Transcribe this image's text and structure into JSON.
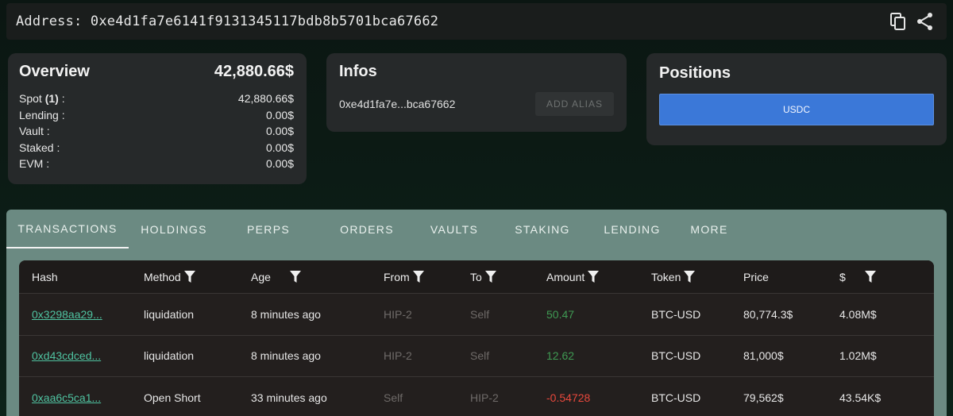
{
  "address_bar": {
    "label": "Address:",
    "address": "0xe4d1fa7e6141f9131345117bdb8b5701bca67662",
    "icons": [
      "copy-icon",
      "share-icon"
    ]
  },
  "overview": {
    "title": "Overview",
    "total": "42,880.66$",
    "rows": [
      {
        "label_prefix": "Spot ",
        "label_bold": "(1)",
        "label_suffix": " :",
        "value": "42,880.66$"
      },
      {
        "label_prefix": "Lending :",
        "label_bold": "",
        "label_suffix": "",
        "value": "0.00$"
      },
      {
        "label_prefix": "Vault :",
        "label_bold": "",
        "label_suffix": "",
        "value": "0.00$"
      },
      {
        "label_prefix": "Staked :",
        "label_bold": "",
        "label_suffix": "",
        "value": "0.00$"
      },
      {
        "label_prefix": "EVM :",
        "label_bold": "",
        "label_suffix": "",
        "value": "0.00$"
      }
    ]
  },
  "infos": {
    "title": "Infos",
    "short_address": "0xe4d1fa7e...bca67662",
    "alias_button": "ADD ALIAS"
  },
  "positions": {
    "title": "Positions",
    "token_button": "USDC"
  },
  "tabs": [
    {
      "label": "TRANSACTIONS",
      "active": true
    },
    {
      "label": "HOLDINGS",
      "active": false
    },
    {
      "label": "PERPS",
      "active": false
    },
    {
      "label": "ORDERS",
      "active": false
    },
    {
      "label": "VAULTS",
      "active": false
    },
    {
      "label": "STAKING",
      "active": false
    },
    {
      "label": "LENDING",
      "active": false
    },
    {
      "label": "MORE",
      "active": false
    }
  ],
  "table": {
    "columns": [
      {
        "label": "Hash",
        "filter": false
      },
      {
        "label": "Method",
        "filter": true
      },
      {
        "label": "Age",
        "filter": true
      },
      {
        "label": "From",
        "filter": true
      },
      {
        "label": "To",
        "filter": true
      },
      {
        "label": "Amount",
        "filter": true
      },
      {
        "label": "Token",
        "filter": true
      },
      {
        "label": "Price",
        "filter": false
      },
      {
        "label": "$",
        "filter": true
      }
    ],
    "rows": [
      {
        "hash": "0x3298aa29...",
        "method": "liquidation",
        "age": "8 minutes ago",
        "from": "HIP-2",
        "to": "Self",
        "amount": "50.47",
        "amount_sign": "pos",
        "token": "BTC-USD",
        "price": "80,774.3$",
        "usd": "4.08M$"
      },
      {
        "hash": "0xd43cdced...",
        "method": "liquidation",
        "age": "8 minutes ago",
        "from": "HIP-2",
        "to": "Self",
        "amount": "12.62",
        "amount_sign": "pos",
        "token": "BTC-USD",
        "price": "81,000$",
        "usd": "1.02M$"
      },
      {
        "hash": "0xaa6c5ca1...",
        "method": "Open Short",
        "age": "33 minutes ago",
        "from": "Self",
        "to": "HIP-2",
        "amount": "-0.54728",
        "amount_sign": "neg",
        "token": "BTC-USD",
        "price": "79,562$",
        "usd": "43.54K$"
      }
    ]
  },
  "colors": {
    "accent_blue": "#3b78d8",
    "link_green": "#4fc3a1",
    "positive_green": "#3f9a53",
    "negative_red": "#e8483c",
    "tab_bar": "#6b8a82"
  }
}
